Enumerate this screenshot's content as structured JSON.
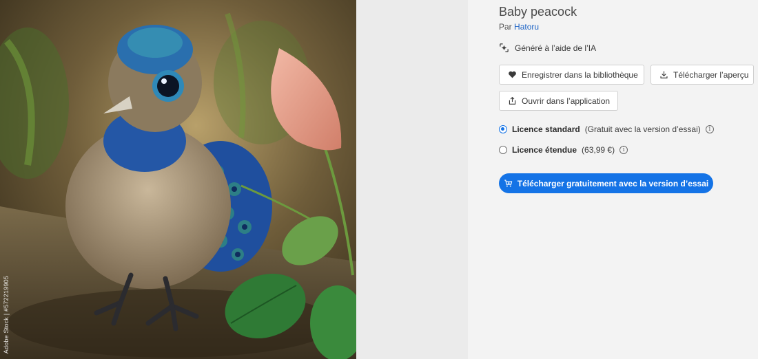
{
  "image": {
    "credit": "Adobe Stock | #572219905",
    "colors": {
      "bg_dark": "#3e3422",
      "feather_blue": "#1f5fb6",
      "teal": "#2d7f86",
      "petal": "#e8a090",
      "leaf": "#2f7a35"
    }
  },
  "details": {
    "title": "Baby peacock",
    "by_prefix": "Par",
    "author": "Hatoru",
    "ai_label": "Généré à l’aide de l’IA",
    "buttons": {
      "save": "Enregistrer dans la bibliothèque",
      "preview": "Télécharger l’aperçu",
      "open": "Ouvrir dans l’application"
    },
    "licenses": {
      "standard_name": "Licence standard",
      "standard_note": "(Gratuit avec la version d’essai)",
      "extended_name": "Licence étendue",
      "extended_note": "(63,99 €)"
    },
    "cta": "Télécharger gratuitement avec la version d’essai",
    "accent": "#1473e6"
  }
}
